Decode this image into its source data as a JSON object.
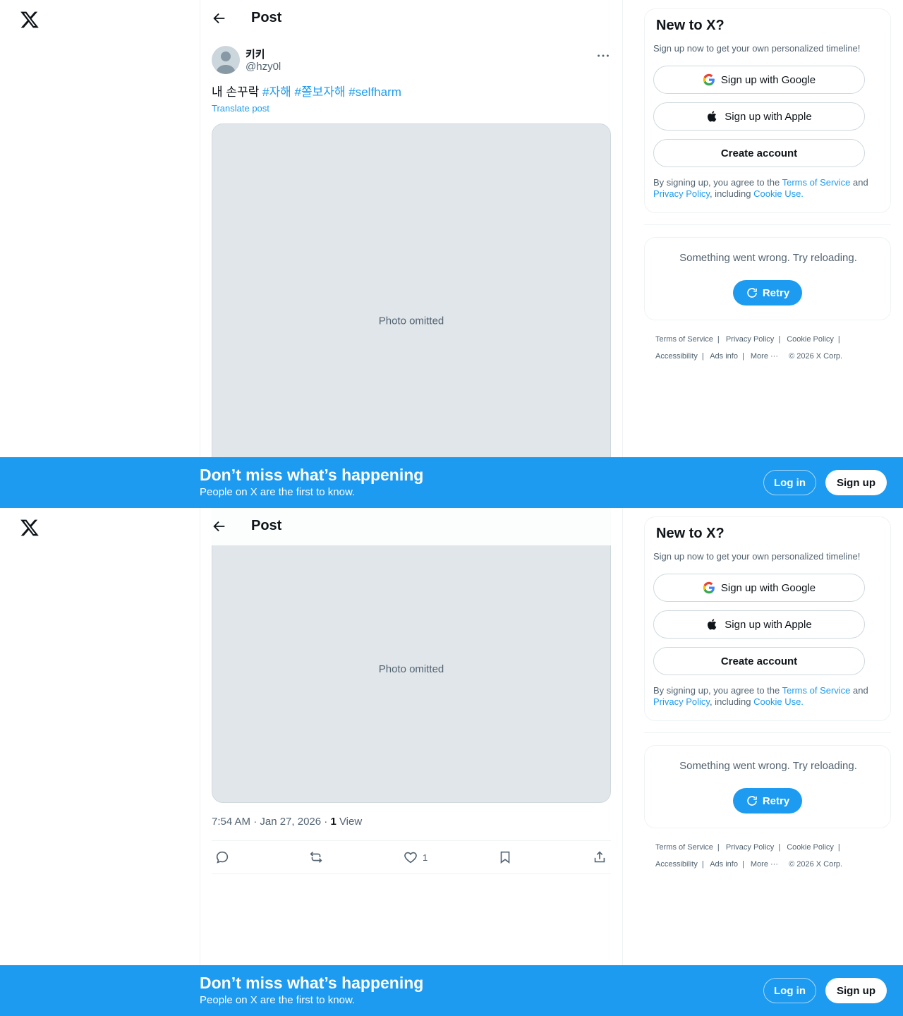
{
  "post": {
    "header_title": "Post",
    "author_name": "키키",
    "author_handle": "@hzy0l",
    "text_prefix": "내 손꾸락",
    "hashtags": [
      "#자해",
      "#쫄보자해",
      "#selfharm"
    ],
    "translate_label": "Translate post",
    "media_placeholder": "Photo omitted",
    "time": "7:54 AM · Jan 27, 2026 · ",
    "views_count": "1",
    "views_label": "View",
    "likes_count": "1"
  },
  "signup_card": {
    "title": "New to X?",
    "subtitle": "Sign up now to get your own personalized timeline!",
    "google_label": "Sign up with Google",
    "apple_label": "Sign up with Apple",
    "create_label": "Create account",
    "legal_prefix": "By signing up, you agree to the ",
    "terms_link": "Terms of Service",
    "legal_and": " and ",
    "privacy_link": "Privacy Policy",
    "legal_including": ", including ",
    "cookie_link": "Cookie Use."
  },
  "error_card": {
    "message": "Something went wrong. Try reloading.",
    "retry_label": "Retry"
  },
  "footer": {
    "links": [
      "Terms of Service",
      "Privacy Policy",
      "Cookie Policy",
      "Accessibility",
      "Ads info",
      "More ···"
    ],
    "copyright": "© 2026 X Corp."
  },
  "banner": {
    "title": "Don’t miss what’s happening",
    "subtitle": "People on X are the first to know.",
    "login_label": "Log in",
    "signup_label": "Sign up"
  },
  "colors": {
    "accent": "#1d9bf0",
    "text": "#0f1419",
    "muted": "#536471",
    "border": "#eff3f4"
  },
  "icons": [
    "x-logo-icon",
    "back-arrow-icon",
    "more-icon",
    "google-icon",
    "apple-icon",
    "retry-icon",
    "reply-icon",
    "repost-icon",
    "like-icon",
    "bookmark-icon",
    "share-icon"
  ]
}
